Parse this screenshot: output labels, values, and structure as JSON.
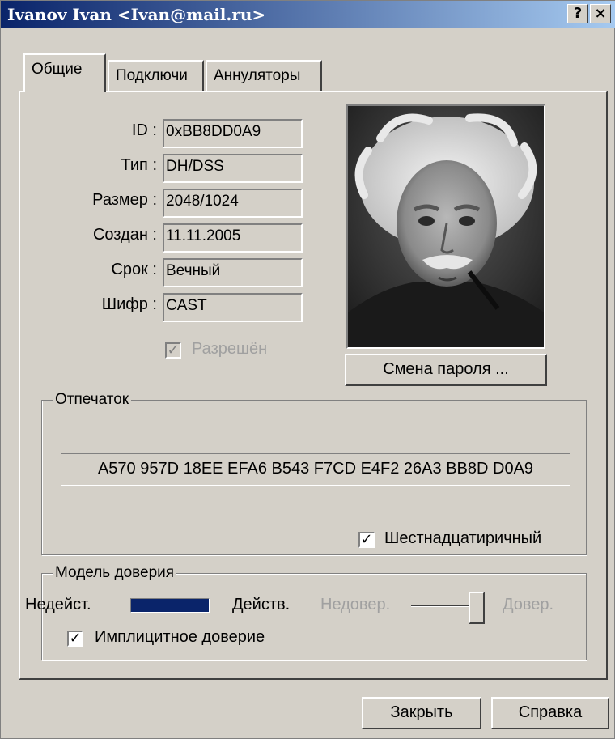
{
  "window": {
    "title": "Ivanov Ivan <Ivan@mail.ru>",
    "help_glyph": "?",
    "close_glyph": "×"
  },
  "tabs": [
    {
      "label": "Общие"
    },
    {
      "label": "Подключи"
    },
    {
      "label": "Аннуляторы"
    }
  ],
  "key_info": {
    "id": {
      "label": "ID :",
      "value": "0xBB8DD0A9"
    },
    "type": {
      "label": "Тип :",
      "value": "DH/DSS"
    },
    "size": {
      "label": "Размер :",
      "value": "2048/1024"
    },
    "created": {
      "label": "Создан :",
      "value": "11.11.2005"
    },
    "expires": {
      "label": "Срок :",
      "value": "Вечный"
    },
    "cipher": {
      "label": "Шифр :",
      "value": "CAST"
    },
    "enabled": {
      "label": "Разрешён",
      "checked": true,
      "disabled": true
    }
  },
  "change_password_label": "Смена пароля ...",
  "fingerprint": {
    "group_label": "Отпечаток",
    "value": "A570 957D 18EE EFA6 B543  F7CD E4F2 26A3 BB8D D0A9",
    "hex": {
      "label": "Шестнадцатиричный",
      "checked": true
    }
  },
  "trust": {
    "group_label": "Модель доверия",
    "invalid_label": "Недейст.",
    "valid_label": "Действ.",
    "validity_bar_color": "#0a246a",
    "untrusted_label": "Недовер.",
    "trusted_label": "Довер.",
    "trust_level": 1.0,
    "implicit": {
      "label": "Имплицитное доверие",
      "checked": true
    }
  },
  "buttons": {
    "close": "Закрыть",
    "help": "Справка"
  }
}
